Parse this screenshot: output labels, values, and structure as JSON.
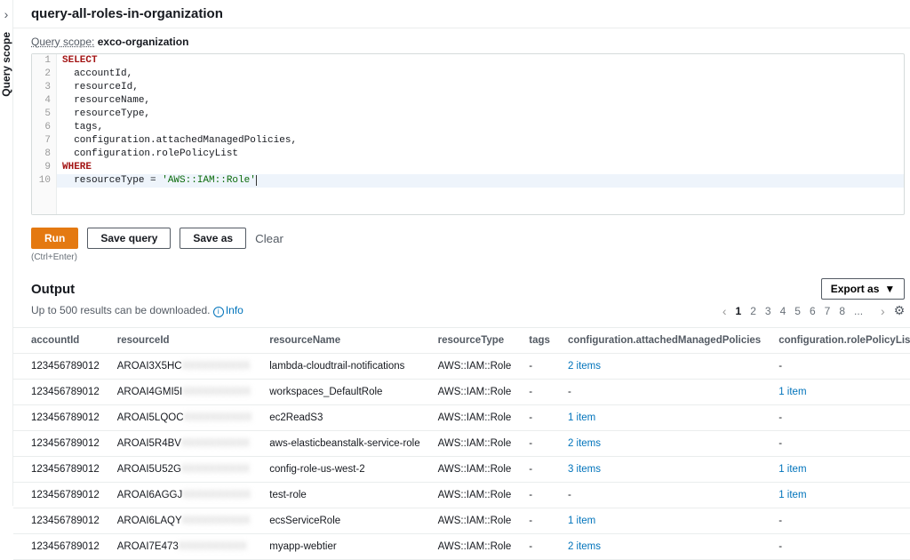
{
  "sidebar": {
    "label": "Query scope"
  },
  "header": {
    "title": "query-all-roles-in-organization"
  },
  "scope": {
    "label": "Query scope:",
    "value": "exco-organization"
  },
  "editor": {
    "lines": [
      {
        "n": 1,
        "tokens": [
          {
            "t": "SELECT",
            "c": "kw"
          }
        ]
      },
      {
        "n": 2,
        "tokens": [
          {
            "t": "  accountId,",
            "c": ""
          }
        ]
      },
      {
        "n": 3,
        "tokens": [
          {
            "t": "  resourceId,",
            "c": ""
          }
        ]
      },
      {
        "n": 4,
        "tokens": [
          {
            "t": "  resourceName,",
            "c": ""
          }
        ]
      },
      {
        "n": 5,
        "tokens": [
          {
            "t": "  resourceType,",
            "c": ""
          }
        ]
      },
      {
        "n": 6,
        "tokens": [
          {
            "t": "  tags,",
            "c": ""
          }
        ]
      },
      {
        "n": 7,
        "tokens": [
          {
            "t": "  configuration.attachedManagedPolicies,",
            "c": ""
          }
        ]
      },
      {
        "n": 8,
        "tokens": [
          {
            "t": "  configuration.rolePolicyList",
            "c": ""
          }
        ]
      },
      {
        "n": 9,
        "tokens": [
          {
            "t": "WHERE",
            "c": "kw"
          }
        ]
      },
      {
        "n": 10,
        "tokens": [
          {
            "t": "  resourceType = ",
            "c": ""
          },
          {
            "t": "'AWS::IAM::Role'",
            "c": "str"
          }
        ],
        "active": true
      }
    ]
  },
  "buttons": {
    "run": "Run",
    "save": "Save query",
    "saveAs": "Save as",
    "clear": "Clear"
  },
  "hint": "(Ctrl+Enter)",
  "output": {
    "heading": "Output",
    "download": "Up to 500 results can be downloaded.",
    "info": "Info",
    "export": "Export as"
  },
  "pager": {
    "pages": [
      "1",
      "2",
      "3",
      "4",
      "5",
      "6",
      "7",
      "8",
      "..."
    ]
  },
  "columns": [
    "accountId",
    "resourceId",
    "resourceName",
    "resourceType",
    "tags",
    "configuration.attachedManagedPolicies",
    "configuration.rolePolicyList"
  ],
  "rows": [
    {
      "accountId": "123456789012",
      "resourceIdPrefix": "AROAI3X5HC",
      "resourceName": "lambda-cloudtrail-notifications",
      "resourceType": "AWS::IAM::Role",
      "tags": "-",
      "amp": "2 items",
      "rpl": "-"
    },
    {
      "accountId": "123456789012",
      "resourceIdPrefix": "AROAI4GMI5I",
      "resourceName": "workspaces_DefaultRole",
      "resourceType": "AWS::IAM::Role",
      "tags": "-",
      "amp": "-",
      "rpl": "1 item"
    },
    {
      "accountId": "123456789012",
      "resourceIdPrefix": "AROAI5LQOC",
      "resourceName": "ec2ReadS3",
      "resourceType": "AWS::IAM::Role",
      "tags": "-",
      "amp": "1 item",
      "rpl": "-"
    },
    {
      "accountId": "123456789012",
      "resourceIdPrefix": "AROAI5R4BV",
      "resourceName": "aws-elasticbeanstalk-service-role",
      "resourceType": "AWS::IAM::Role",
      "tags": "-",
      "amp": "2 items",
      "rpl": "-"
    },
    {
      "accountId": "123456789012",
      "resourceIdPrefix": "AROAI5U52G",
      "resourceName": "config-role-us-west-2",
      "resourceType": "AWS::IAM::Role",
      "tags": "-",
      "amp": "3 items",
      "rpl": "1 item"
    },
    {
      "accountId": "123456789012",
      "resourceIdPrefix": "AROAI6AGGJ",
      "resourceName": "test-role",
      "resourceType": "AWS::IAM::Role",
      "tags": "-",
      "amp": "-",
      "rpl": "1 item"
    },
    {
      "accountId": "123456789012",
      "resourceIdPrefix": "AROAI6LAQY",
      "resourceName": "ecsServiceRole",
      "resourceType": "AWS::IAM::Role",
      "tags": "-",
      "amp": "1 item",
      "rpl": "-"
    },
    {
      "accountId": "123456789012",
      "resourceIdPrefix": "AROAI7E473",
      "resourceName": "myapp-webtier",
      "resourceType": "AWS::IAM::Role",
      "tags": "-",
      "amp": "2 items",
      "rpl": "-"
    }
  ]
}
